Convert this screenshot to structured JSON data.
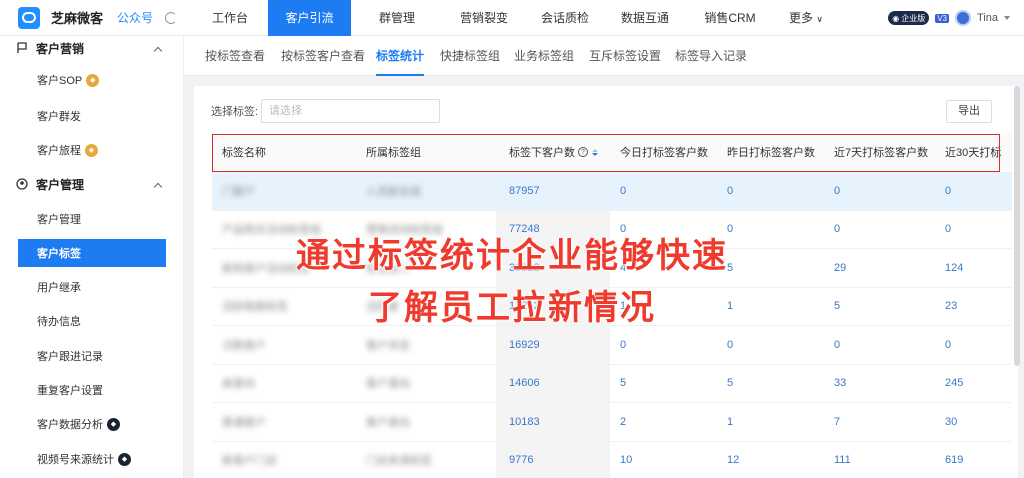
{
  "topbar": {
    "brand": "芝麻微客",
    "brand_sub": "公众号",
    "nav": [
      {
        "label": "工作台"
      },
      {
        "label": "客户引流"
      },
      {
        "label": "群管理"
      },
      {
        "label": "营销裂变"
      },
      {
        "label": "会话质检"
      },
      {
        "label": "数据互通"
      },
      {
        "label": "销售CRM"
      },
      {
        "label": "更多"
      }
    ],
    "active_nav": "客户引流",
    "edition": "企业版",
    "edition_level": "V3",
    "user": "Tina"
  },
  "sidebar": {
    "groups": [
      {
        "title": "客户营销"
      },
      {
        "title": "客户管理"
      }
    ],
    "items": [
      {
        "label": "客户SOP"
      },
      {
        "label": "客户群发"
      },
      {
        "label": "客户旅程"
      },
      {
        "label": "客户管理"
      },
      {
        "label": "客户标签"
      },
      {
        "label": "用户继承"
      },
      {
        "label": "待办信息"
      },
      {
        "label": "客户跟进记录"
      },
      {
        "label": "重复客户设置"
      },
      {
        "label": "客户数据分析"
      },
      {
        "label": "视频号来源统计"
      }
    ],
    "active_item": "客户标签"
  },
  "subtabs": [
    {
      "label": "按标签查看"
    },
    {
      "label": "按标签客户查看"
    },
    {
      "label": "标签统计"
    },
    {
      "label": "快捷标签组"
    },
    {
      "label": "业务标签组"
    },
    {
      "label": "互斥标签设置"
    },
    {
      "label": "标签导入记录"
    }
  ],
  "active_subtab": "标签统计",
  "filter": {
    "label": "选择标签:",
    "placeholder": "请选择",
    "export_label": "导出"
  },
  "table": {
    "headers": [
      "标签名称",
      "所属标签组",
      "标签下客户数",
      "今日打标签客户数",
      "昨日打标签客户数",
      "近7天打标签客户数",
      "近30天打标"
    ],
    "rows": [
      {
        "name": "门客户",
        "group": "人员配合组",
        "total": "87957",
        "today": "0",
        "yesterday": "0",
        "d7": "0",
        "d30": "0"
      },
      {
        "name": "产品购买活动标签组",
        "group": "营销活动标签组",
        "total": "77248",
        "today": "0",
        "yesterday": "0",
        "d7": "0",
        "d30": "0"
      },
      {
        "name": "新购客户活动标签",
        "group": "标签组二",
        "total": "33922",
        "today": "4",
        "yesterday": "5",
        "d7": "29",
        "d30": "124"
      },
      {
        "name": "活跃程度标签",
        "group": "活跃度",
        "total": "17242",
        "today": "1",
        "yesterday": "1",
        "d7": "5",
        "d30": "23"
      },
      {
        "name": "沉默客户",
        "group": "客户状态",
        "total": "16929",
        "today": "0",
        "yesterday": "0",
        "d7": "0",
        "d30": "0"
      },
      {
        "name": "高意向",
        "group": "客户意向",
        "total": "14606",
        "today": "5",
        "yesterday": "5",
        "d7": "33",
        "d30": "245"
      },
      {
        "name": "普通客户",
        "group": "客户意向",
        "total": "10183",
        "today": "2",
        "yesterday": "1",
        "d7": "7",
        "d30": "30"
      },
      {
        "name": "新客户门店",
        "group": "门店来源标签",
        "total": "9776",
        "today": "10",
        "yesterday": "12",
        "d7": "111",
        "d30": "619"
      }
    ]
  },
  "overlay": {
    "line1": "通过标签统计企业能够快速",
    "line2": "了解员工拉新情况"
  },
  "colors": {
    "accent": "#1e7cf2",
    "highlight_row": "#e6f3fc",
    "overlay_text": "#ef3b2d",
    "header_box": "#d62d2d"
  }
}
